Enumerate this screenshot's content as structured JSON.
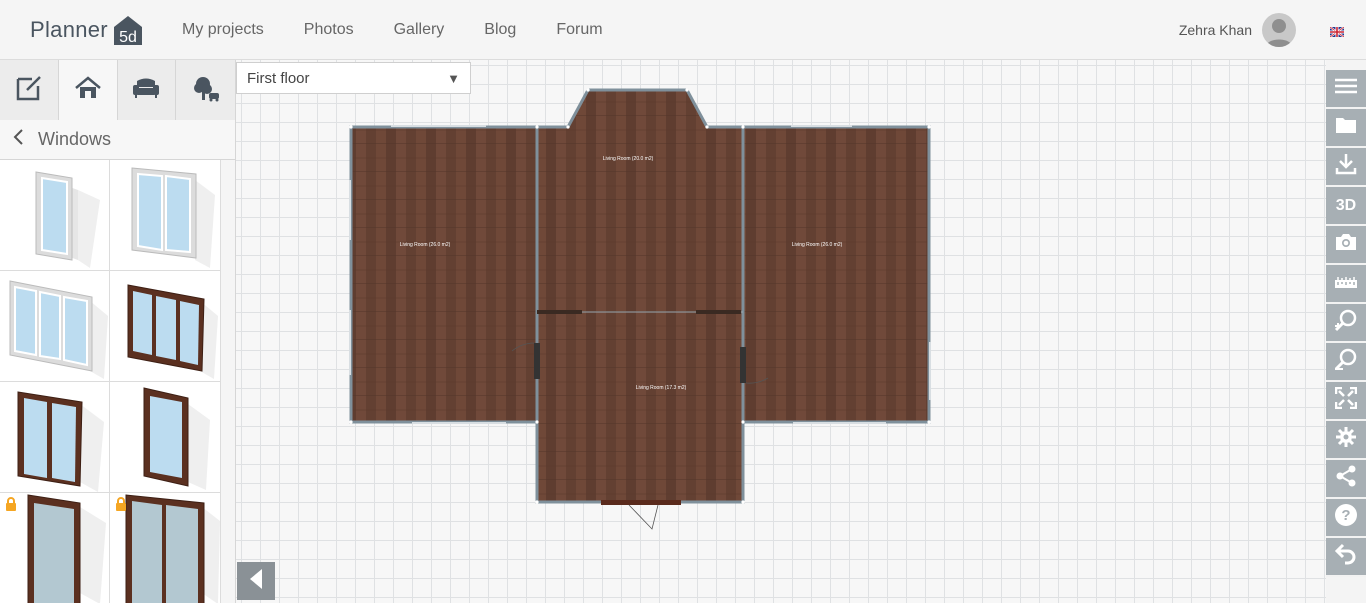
{
  "app": {
    "logo_text": "Planner",
    "logo_badge": "5d"
  },
  "nav": [
    "My projects",
    "Photos",
    "Gallery",
    "Blog",
    "Forum"
  ],
  "user": {
    "name": "Zehra Khan"
  },
  "left_panel": {
    "tabs": [
      "edit-plan-icon",
      "home-icon",
      "sofa-icon",
      "tree-icon"
    ],
    "category": "Windows",
    "items": [
      {
        "icon": "white-single-window",
        "locked": false
      },
      {
        "icon": "white-double-window",
        "locked": false
      },
      {
        "icon": "white-triple-window",
        "locked": false
      },
      {
        "icon": "wood-triple-window",
        "locked": false
      },
      {
        "icon": "wood-double-window",
        "locked": false
      },
      {
        "icon": "wood-single-window",
        "locked": false
      },
      {
        "icon": "wood-single-glass-window",
        "locked": true
      },
      {
        "icon": "wood-sliding-window",
        "locked": true
      }
    ]
  },
  "floor_selector": {
    "value": "First floor"
  },
  "plan": {
    "rooms": [
      {
        "label": "Living Room (26.0 m2)"
      },
      {
        "label": "Living Room (20.0 m2)"
      },
      {
        "label": "Living Room (26.0 m2)"
      },
      {
        "label": "Living Room (17.3 m2)"
      }
    ]
  },
  "right_toolbar": {
    "buttons": [
      "menu-icon",
      "folder-icon",
      "download-icon",
      "3D",
      "camera-icon",
      "ruler-icon",
      "zoom-in-icon",
      "zoom-out-icon",
      "fullscreen-icon",
      "settings-icon",
      "share-icon",
      "help-icon",
      "undo-icon"
    ],
    "label_3d": "3D"
  },
  "colors": {
    "toolbar": "#a7afb4",
    "floor": "#6b4636",
    "wall": "#7f909b",
    "accent": "#f5a623"
  }
}
